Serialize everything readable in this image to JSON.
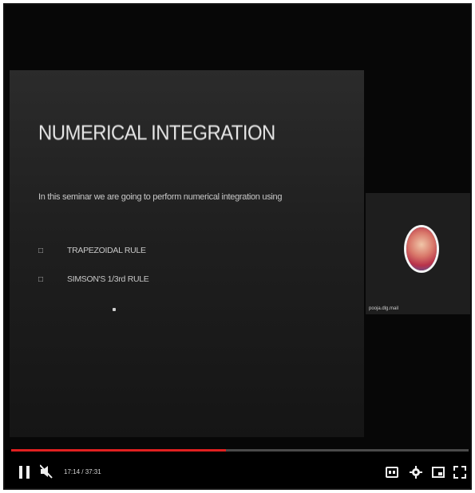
{
  "slide": {
    "title": "NUMERICAL INTEGRATION",
    "subtitle": "In this seminar we are going to perform numerical integration using",
    "bullets": [
      {
        "marker": "□",
        "text": "TRAPEZOIDAL RULE"
      },
      {
        "marker": "□",
        "text": "SIMSON'S 1/3rd RULE"
      }
    ]
  },
  "participant": {
    "name": "pooja.dlg.mail"
  },
  "player": {
    "time": "17:14 / 37:31",
    "progress_fraction": 0.47,
    "colors": {
      "progress": "#e02020",
      "track": "#4a4a4a"
    },
    "icons": {
      "play_pause": "pause-icon",
      "volume": "volume-muted-icon",
      "captions": "captions-icon",
      "settings": "gear-icon",
      "miniplayer": "miniplayer-icon",
      "fullscreen": "fullscreen-icon"
    }
  }
}
